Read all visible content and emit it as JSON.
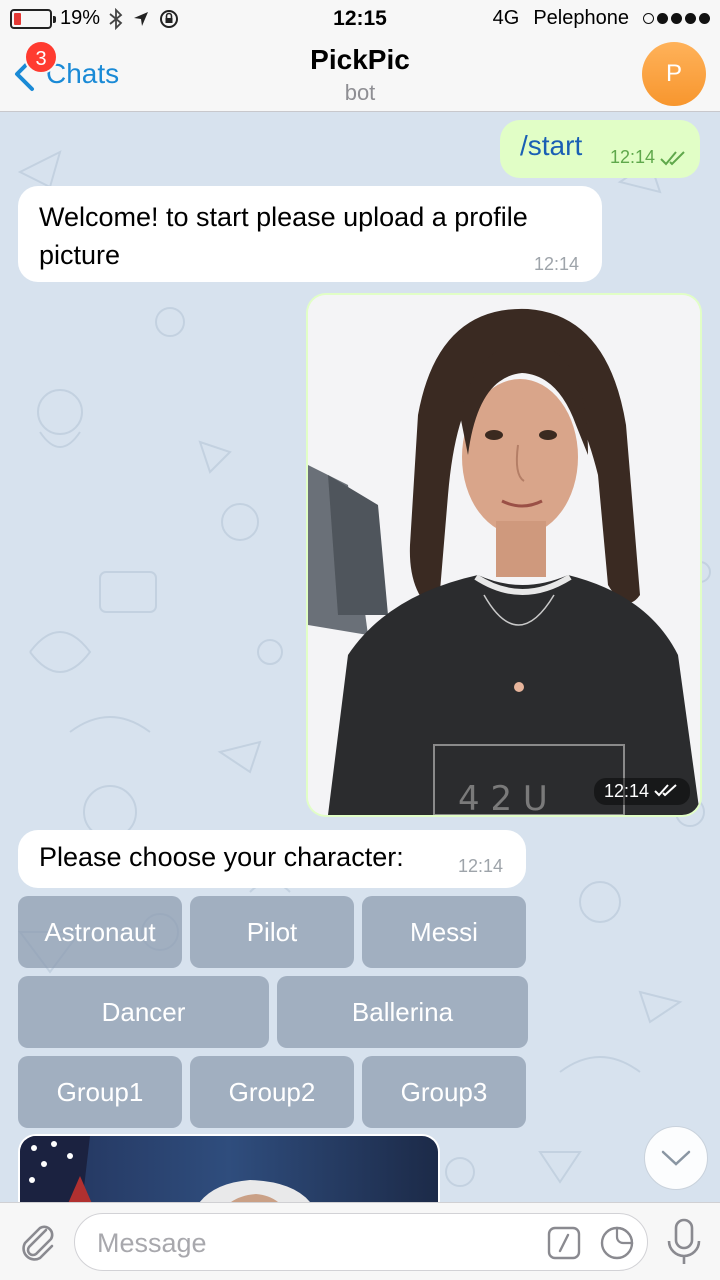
{
  "status_bar": {
    "battery": "19%",
    "battery_level": 0.19,
    "time": "12:15",
    "network": "4G",
    "carrier": "Pelephone",
    "icons": [
      "bluetooth-icon",
      "location-icon",
      "rotation-lock-icon"
    ]
  },
  "nav": {
    "back_label": "Chats",
    "unread_count": "3",
    "title": "PickPic",
    "subtitle": "bot",
    "avatar_letter": "P"
  },
  "messages": [
    {
      "direction": "out",
      "text": "/start",
      "time": "12:14",
      "status": "read"
    },
    {
      "direction": "in",
      "text": "Welcome! to start please upload a profile picture",
      "time": "12:14"
    },
    {
      "direction": "out",
      "type": "photo",
      "time": "12:14",
      "status": "read"
    },
    {
      "direction": "in",
      "text": "Please choose your character:",
      "time": "12:14"
    }
  ],
  "keyboard": {
    "row1": [
      "Astronaut",
      "Pilot",
      "Messi"
    ],
    "row2": [
      "Dancer",
      "Ballerina"
    ],
    "row3": [
      "Group1",
      "Group2",
      "Group3"
    ]
  },
  "input": {
    "placeholder": "Message"
  },
  "colors": {
    "accent": "#1a8ad6",
    "outgoing_bubble": "#e1fec6",
    "incoming_bubble": "#ffffff",
    "badge": "#ff3b30",
    "avatar": "#f7962e",
    "chat_background": "#d7e2ee"
  }
}
